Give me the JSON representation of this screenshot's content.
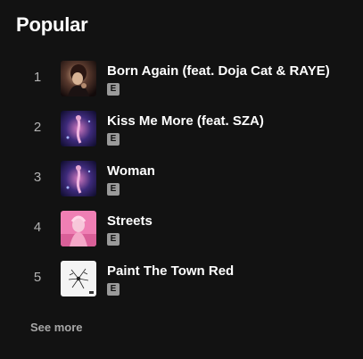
{
  "section": {
    "title": "Popular",
    "see_more_label": "See more"
  },
  "tracks": [
    {
      "index": "1",
      "title": "Born Again (feat. Doja Cat & RAYE)",
      "explicit_badge": "E",
      "art_icon": "album-art-born-again"
    },
    {
      "index": "2",
      "title": "Kiss Me More (feat. SZA)",
      "explicit_badge": "E",
      "art_icon": "album-art-planet-her"
    },
    {
      "index": "3",
      "title": "Woman",
      "explicit_badge": "E",
      "art_icon": "album-art-planet-her"
    },
    {
      "index": "4",
      "title": "Streets",
      "explicit_badge": "E",
      "art_icon": "album-art-hot-pink"
    },
    {
      "index": "5",
      "title": "Paint The Town Red",
      "explicit_badge": "E",
      "art_icon": "album-art-scarlet"
    }
  ],
  "colors": {
    "background": "#121212",
    "primary_text": "#ffffff",
    "secondary_text": "#b3b3b3",
    "badge_bg": "#9a9a9a"
  }
}
